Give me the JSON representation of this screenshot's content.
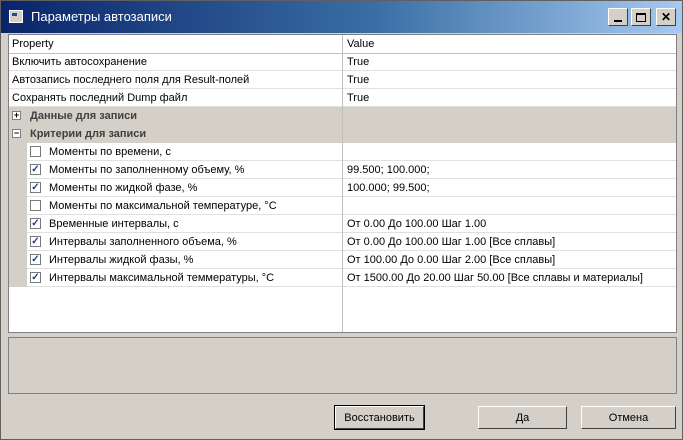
{
  "window": {
    "title": "Параметры автозаписи"
  },
  "grid": {
    "columns": {
      "property": "Property",
      "value": "Value"
    },
    "rows": [
      {
        "name": "Включить автосохранение",
        "value": "True"
      },
      {
        "name": "Автозапись последнего поля для Result-полей",
        "value": "True"
      },
      {
        "name": "Сохранять последний Dump файл",
        "value": "True"
      }
    ],
    "categories": [
      {
        "name": "Данные для записи",
        "expanded": false,
        "expander": "+"
      },
      {
        "name": "Критерии для записи",
        "expanded": true,
        "expander": "−"
      }
    ],
    "criteria": [
      {
        "name": "Моменты по времени, с",
        "checked": false,
        "mark": "",
        "value": ""
      },
      {
        "name": "Моменты по заполненному объему, %",
        "checked": true,
        "mark": "✓",
        "value": "99.500; 100.000;"
      },
      {
        "name": "Моменты по жидкой фазе, %",
        "checked": true,
        "mark": "✓",
        "value": "100.000; 99.500;"
      },
      {
        "name": "Моменты по максимальной температуре, °C",
        "checked": false,
        "mark": "",
        "value": ""
      },
      {
        "name": "Временные интервалы, с",
        "checked": true,
        "mark": "✓",
        "value": "От 0.00 До 100.00 Шаг 1.00"
      },
      {
        "name": "Интервалы заполненного объема, %",
        "checked": true,
        "mark": "✓",
        "value": "От 0.00 До 100.00 Шаг 1.00 [Все сплавы]"
      },
      {
        "name": "Интервалы жидкой фазы, %",
        "checked": true,
        "mark": "✓",
        "value": "От 100.00 До 0.00 Шаг 2.00 [Все сплавы]"
      },
      {
        "name": "Интервалы максимальной теммературы, °C",
        "checked": true,
        "mark": "✓",
        "value": "От 1500.00 До 20.00 Шаг 50.00 [Все сплавы и материалы]"
      }
    ]
  },
  "buttons": {
    "restore": "Восстановить",
    "ok": "Да",
    "cancel": "Отмена"
  },
  "icons": {
    "app": "app-window-icon",
    "minimize": "minimize-icon",
    "maximize": "maximize-icon",
    "close": "close-icon"
  }
}
